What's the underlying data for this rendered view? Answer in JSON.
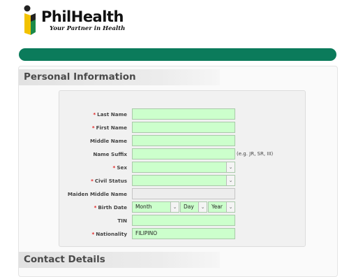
{
  "brand": {
    "name": "PhilHealth",
    "tagline": "Your Partner in Health",
    "colors": {
      "green": "#0b7b5b",
      "yellow": "#f2c200",
      "field": "#ccffcc"
    }
  },
  "sections": {
    "personal": "Personal Information",
    "contact": "Contact Details"
  },
  "form": {
    "last_name": {
      "label": "Last Name",
      "required": true,
      "value": ""
    },
    "first_name": {
      "label": "First Name",
      "required": true,
      "value": ""
    },
    "middle_name": {
      "label": "Middle Name",
      "required": false,
      "value": ""
    },
    "name_suffix": {
      "label": "Name Suffix",
      "required": false,
      "value": "",
      "hint": "(e.g. JR, SR, III)"
    },
    "sex": {
      "label": "Sex",
      "required": true,
      "value": ""
    },
    "civil_status": {
      "label": "Civil Status",
      "required": true,
      "value": ""
    },
    "maiden_middle_name": {
      "label": "Maiden Middle Name",
      "required": false,
      "value": ""
    },
    "birth_date": {
      "label": "Birth Date",
      "required": true,
      "month": "Month",
      "day": "Day",
      "year": "Year"
    },
    "tin": {
      "label": "TIN",
      "required": false,
      "value": ""
    },
    "nationality": {
      "label": "Nationality",
      "required": true,
      "value": "FILIPINO"
    }
  },
  "required_marker": "*",
  "icons": {
    "dropdown": "chevron-down-icon",
    "logo": "philhealth-logo-icon"
  }
}
